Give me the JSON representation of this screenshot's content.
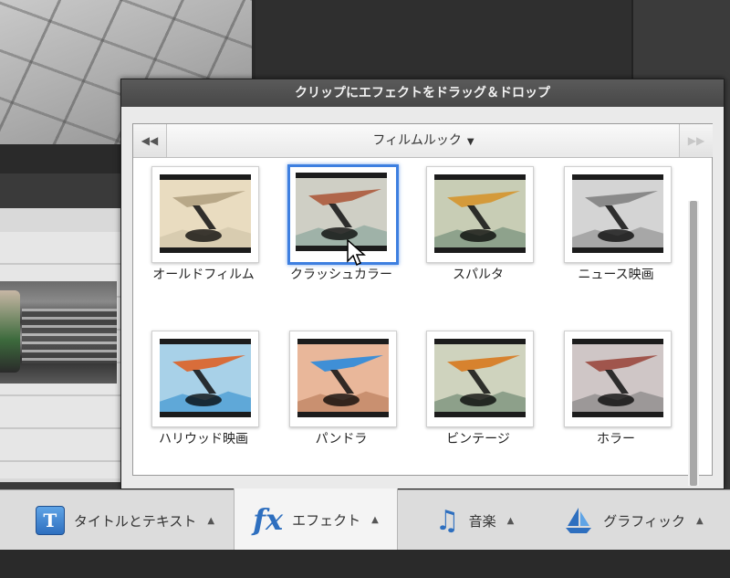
{
  "panel": {
    "title": "クリップにエフェクトをドラッグ＆ドロップ",
    "category": "フィルムルック",
    "prev_icon": "double-chevron-left-icon",
    "next_icon": "double-chevron-right-icon"
  },
  "effects": [
    {
      "label": "オールドフィルム",
      "sky": "#e9dcc0",
      "glider": "#b8a888",
      "hills": "#d8ccb0",
      "selected": false
    },
    {
      "label": "クラッシュカラー",
      "sky": "#cfcfc5",
      "glider": "#b0664a",
      "hills": "#9fb2a8",
      "selected": true
    },
    {
      "label": "スパルタ",
      "sky": "#c8cdb5",
      "glider": "#d49a3a",
      "hills": "#8ea28c",
      "selected": false
    },
    {
      "label": "ニュース映画",
      "sky": "#d4d4d4",
      "glider": "#8a8a8a",
      "hills": "#a7a7a7",
      "selected": false
    },
    {
      "label": "ハリウッド映画",
      "sky": "#a8d1e8",
      "glider": "#d86d3a",
      "hills": "#5fa8d8",
      "selected": false
    },
    {
      "label": "パンドラ",
      "sky": "#e9b79a",
      "glider": "#3f8fd6",
      "hills": "#c99070",
      "selected": false
    },
    {
      "label": "ビンテージ",
      "sky": "#cfd3be",
      "glider": "#d7822e",
      "hills": "#8da08a",
      "selected": false
    },
    {
      "label": "ホラー",
      "sky": "#cfc6c6",
      "glider": "#a0554c",
      "hills": "#9c9898",
      "selected": false
    }
  ],
  "toolbar": {
    "tabs": [
      {
        "label": "タイトルとテキスト",
        "icon": "title-text-icon",
        "active": false
      },
      {
        "label": "エフェクト",
        "icon": "fx-icon",
        "active": true
      },
      {
        "label": "音楽",
        "icon": "music-note-icon",
        "active": false
      },
      {
        "label": "グラフィック",
        "icon": "sailboat-icon",
        "active": false
      }
    ]
  }
}
